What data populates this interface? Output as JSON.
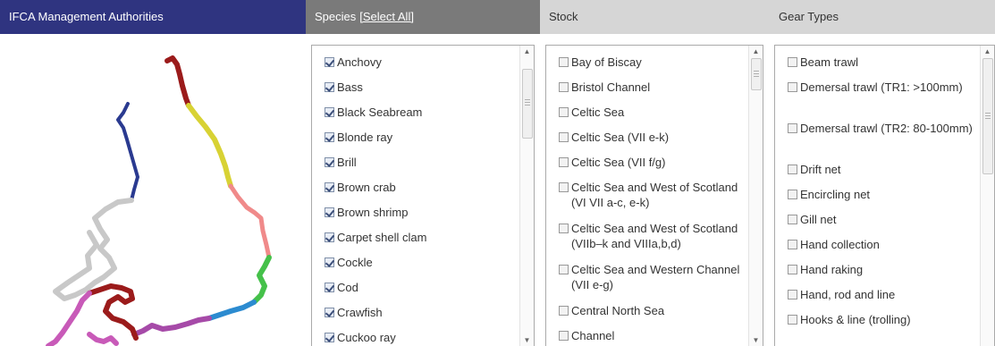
{
  "headers": {
    "ifca": "IFCA Management Authorities",
    "species": "Species",
    "species_select_all": "[Select All]",
    "stock": "Stock",
    "gear": "Gear Types"
  },
  "map_colors": {
    "dark_red": "#9b1b1b",
    "yellow": "#d8d234",
    "navy": "#2a3a90",
    "pink": "#f08a8a",
    "grey": "#c8c8c8",
    "green": "#45c14a",
    "blue": "#2c8bd0",
    "purple": "#a64aa8",
    "magenta": "#c85ab8"
  },
  "species": [
    {
      "label": "Anchovy",
      "checked": true
    },
    {
      "label": "Bass",
      "checked": true
    },
    {
      "label": "Black Seabream",
      "checked": true
    },
    {
      "label": "Blonde ray",
      "checked": true
    },
    {
      "label": "Brill",
      "checked": true
    },
    {
      "label": "Brown crab",
      "checked": true
    },
    {
      "label": "Brown shrimp",
      "checked": true
    },
    {
      "label": "Carpet shell clam",
      "checked": true
    },
    {
      "label": "Cockle",
      "checked": true
    },
    {
      "label": "Cod",
      "checked": true
    },
    {
      "label": "Crawfish",
      "checked": true
    },
    {
      "label": "Cuckoo ray",
      "checked": true
    }
  ],
  "stock": [
    {
      "label": "Bay of Biscay",
      "checked": false
    },
    {
      "label": "Bristol Channel",
      "checked": false
    },
    {
      "label": "Celtic Sea",
      "checked": false
    },
    {
      "label": "Celtic Sea (VII e-k)",
      "checked": false
    },
    {
      "label": "Celtic Sea (VII f/g)",
      "checked": false
    },
    {
      "label": "Celtic Sea and West of Scotland (VI VII a-c, e-k)",
      "checked": false
    },
    {
      "label": "Celtic Sea and West of Scotland (VIIb–k and VIIIa,b,d)",
      "checked": false
    },
    {
      "label": "Celtic Sea and Western Channel (VII e-g)",
      "checked": false
    },
    {
      "label": "Central North Sea",
      "checked": false
    },
    {
      "label": "Channel",
      "checked": false
    }
  ],
  "gear": [
    {
      "label": "Beam trawl",
      "checked": false
    },
    {
      "label": "Demersal trawl (TR1: >100mm)",
      "checked": false
    },
    {
      "label": "Demersal trawl (TR2: 80-100mm)",
      "checked": false
    },
    {
      "label": "Drift net",
      "checked": false
    },
    {
      "label": "Encircling net",
      "checked": false
    },
    {
      "label": "Gill net",
      "checked": false
    },
    {
      "label": "Hand collection",
      "checked": false
    },
    {
      "label": "Hand raking",
      "checked": false
    },
    {
      "label": "Hand, rod and line",
      "checked": false
    },
    {
      "label": "Hooks & line (trolling)",
      "checked": false
    }
  ]
}
